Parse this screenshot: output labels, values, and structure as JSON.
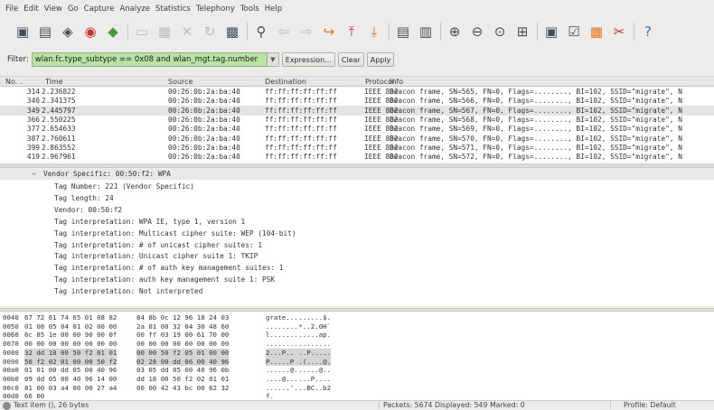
{
  "menubar": {
    "items": [
      "File",
      "Edit",
      "View",
      "Go",
      "Capture",
      "Analyze",
      "Statistics",
      "Telephony",
      "Tools",
      "Help"
    ]
  },
  "toolbar": {
    "buttons": [
      {
        "name": "interfaces",
        "glyph": "▣"
      },
      {
        "name": "capture-options",
        "glyph": "▤"
      },
      {
        "name": "start-capture",
        "glyph": "◈"
      },
      {
        "name": "stop-capture",
        "glyph": "◉"
      },
      {
        "name": "restart-capture",
        "glyph": "◆"
      },
      {
        "name": "open",
        "glyph": "▭"
      },
      {
        "name": "save",
        "glyph": "▦"
      },
      {
        "name": "close",
        "glyph": "✕"
      },
      {
        "name": "reload",
        "glyph": "↻"
      },
      {
        "name": "print",
        "glyph": "▩"
      },
      {
        "name": "find",
        "glyph": "⚲"
      },
      {
        "name": "go-back",
        "glyph": "⇦"
      },
      {
        "name": "go-forward",
        "glyph": "⇨"
      },
      {
        "name": "go-to-packet",
        "glyph": "↪"
      },
      {
        "name": "go-first",
        "glyph": "⤒"
      },
      {
        "name": "go-last",
        "glyph": "⤓"
      },
      {
        "name": "colorize",
        "glyph": "▤"
      },
      {
        "name": "autoscroll",
        "glyph": "▥"
      },
      {
        "name": "zoom-in",
        "glyph": "⊕"
      },
      {
        "name": "zoom-out",
        "glyph": "⊖"
      },
      {
        "name": "normal-size",
        "glyph": "⊙"
      },
      {
        "name": "resize-columns",
        "glyph": "⊞"
      },
      {
        "name": "capture-filters",
        "glyph": "▣"
      },
      {
        "name": "display-filters",
        "glyph": "☑"
      },
      {
        "name": "coloring-rules",
        "glyph": "▦"
      },
      {
        "name": "preferences",
        "glyph": "✂"
      },
      {
        "name": "help",
        "glyph": "?"
      }
    ]
  },
  "filter": {
    "label": "Filter:",
    "value": "wlan.fc.type_subtype == 0x08 and wlan_mgt.tag.number",
    "dropdown_glyph": "▼",
    "expression_label": "Expression...",
    "clear_label": "Clear",
    "apply_label": "Apply",
    "valid_color": "#b9e3a4"
  },
  "packet_list": {
    "columns": [
      "No. .",
      "Time",
      "Source",
      "Destination",
      "Protocol",
      "Info"
    ],
    "rows": [
      {
        "no": "314",
        "time": "2.236822",
        "src": "00:26:0b:2a:ba:40",
        "dst": "ff:ff:ff:ff:ff:ff",
        "proto": "IEEE 802",
        "info": "Beacon frame, SN=565, FN=0, Flags=........, BI=102, SSID=\"migrate\", N",
        "selected": false
      },
      {
        "no": "340",
        "time": "2.341375",
        "src": "00:26:0b:2a:ba:40",
        "dst": "ff:ff:ff:ff:ff:ff",
        "proto": "IEEE 802",
        "info": "Beacon frame, SN=566, FN=0, Flags=........, BI=102, SSID=\"migrate\", N",
        "selected": false
      },
      {
        "no": "349",
        "time": "2.445797",
        "src": "00:26:0b:2a:ba:40",
        "dst": "ff:ff:ff:ff:ff:ff",
        "proto": "IEEE 802",
        "info": "Beacon frame, SN=567, FN=0, Flags=........, BI=102, SSID=\"migrate\", N",
        "selected": true
      },
      {
        "no": "366",
        "time": "2.550225",
        "src": "00:26:0b:2a:ba:40",
        "dst": "ff:ff:ff:ff:ff:ff",
        "proto": "IEEE 802",
        "info": "Beacon frame, SN=568, FN=0, Flags=........, BI=102, SSID=\"migrate\", N",
        "selected": false
      },
      {
        "no": "377",
        "time": "2.654633",
        "src": "00:26:0b:2a:ba:40",
        "dst": "ff:ff:ff:ff:ff:ff",
        "proto": "IEEE 802",
        "info": "Beacon frame, SN=569, FN=0, Flags=........, BI=102, SSID=\"migrate\", N",
        "selected": false
      },
      {
        "no": "387",
        "time": "2.760611",
        "src": "00:26:0b:2a:ba:40",
        "dst": "ff:ff:ff:ff:ff:ff",
        "proto": "IEEE 802",
        "info": "Beacon frame, SN=570, FN=0, Flags=........, BI=102, SSID=\"migrate\", N",
        "selected": false
      },
      {
        "no": "399",
        "time": "2.863552",
        "src": "00:26:0b:2a:ba:40",
        "dst": "ff:ff:ff:ff:ff:ff",
        "proto": "IEEE 802",
        "info": "Beacon frame, SN=571, FN=0, Flags=........, BI=102, SSID=\"migrate\", N",
        "selected": false
      },
      {
        "no": "419",
        "time": "2.967961",
        "src": "00:26:0b:2a:ba:40",
        "dst": "ff:ff:ff:ff:ff:ff",
        "proto": "IEEE 802",
        "info": "Beacon frame, SN=572, FN=0, Flags=........, BI=102, SSID=\"migrate\", N",
        "selected": false
      }
    ]
  },
  "details": {
    "expander": "−",
    "header": "Vendor Specific: 00:50:f2: WPA",
    "lines": [
      "Tag Number: 221 (Vendor Specific)",
      "Tag length: 24",
      "Vendor: 00:50:f2",
      "Tag interpretation: WPA IE, type 1, version 1",
      "Tag interpretation: Multicast cipher suite: WEP (104-bit)",
      "Tag interpretation: # of unicast cipher suites: 1",
      "Tag interpretation: Unicast cipher suite 1: TKIP",
      "Tag interpretation: # of auth key management suites: 1",
      "Tag interpretation: auth key management suite 1: PSK",
      "Tag interpretation: Not interpreted"
    ]
  },
  "hex": {
    "rows": [
      {
        "off": "0040",
        "h1": "67 72 61 74 65 01 08 82",
        "h2": "84 8b 0c 12 96 18 24 03",
        "a1": "grate...",
        "a2": " ......$."
      },
      {
        "off": "0050",
        "h1": "01 08 05 04 01 02 00 00",
        "h2": "2a 01 00 32 04 30 48 60",
        "a1": "........",
        "a2": " *..2.0H`"
      },
      {
        "off": "0060",
        "h1": "6c 85 1e 00 00 90 00 0f",
        "h2": "00 ff 03 19 00 61 70 00",
        "a1": "l.......",
        "a2": " .....ap."
      },
      {
        "off": "0070",
        "h1": "00 00 00 00 00 00 00 00",
        "h2": "00 00 00 00 00 00 00 00",
        "a1": "........",
        "a2": " ........"
      },
      {
        "off": "0080",
        "h1": "32 dd 18 00 50 f2 01 01",
        "h2": "00 00 50 f2 05 01 00 00",
        "a1": "2...P...",
        "a2": " ..P....."
      },
      {
        "off": "0090",
        "h1": "50 f2 02 01 00 00 50 f2",
        "h2": "02 28 00 dd 06 00 40 96",
        "a1": "P.....P.",
        "a2": " .(....@."
      },
      {
        "off": "00a0",
        "h1": "01 01 00 dd 05 00 40 96",
        "h2": "03 05 dd 05 00 40 96 0b",
        "a1": "......@.",
        "a2": " .....@.."
      },
      {
        "off": "00b0",
        "h1": "09 dd 05 00 40 96 14 00",
        "h2": "dd 18 00 50 f2 02 01 01",
        "a1": "....@...",
        "a2": " ...P...."
      },
      {
        "off": "00c0",
        "h1": "81 00 03 a4 00 00 27 a4",
        "h2": "00 00 42 43 bc 00 62 32",
        "a1": "......'.",
        "a2": " ..BC..b2"
      },
      {
        "off": "00d0",
        "h1": "66 00",
        "h2": "",
        "a1": "f.",
        "a2": ""
      }
    ]
  },
  "statusbar": {
    "left": "Text item (), 26 bytes",
    "middle": "Packets: 5674 Displayed: 549 Marked: 0",
    "right": "Profile: Default"
  }
}
